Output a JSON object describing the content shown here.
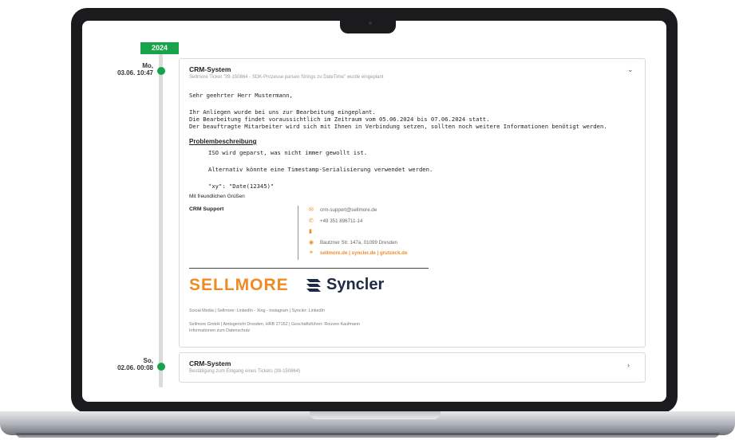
{
  "timeline": {
    "year": "2024",
    "entries": [
      {
        "day": "Mo,",
        "datetime": "03.06. 10:47",
        "title": "CRM-System",
        "subtitle": "Sellmore Ticket \"39-150864 - SDK-Prozesse parsen Strings zu DateTime\" wurde eingeplant",
        "greeting": "Sehr geehrter Herr Mustermann,",
        "body_lines": [
          "Ihr Anliegen wurde bei uns zur Bearbeitung eingeplant.",
          "Die Bearbeitung findet voraussichtlich im Zeitraum vom 05.06.2024 bis 07.06.2024 statt.",
          "Der beauftragte Mitarbeiter wird sich mit Ihnen in Verbindung setzen, sollten noch weitere Informationen benötigt werden."
        ],
        "problem_heading": "Problembeschreibung",
        "problem_lines": [
          "ISO wird geparst, was nicht immer gewollt ist.",
          "Alternativ könnte eine Timestamp-Serialisierung verwendet werden.",
          "\"xy\": \"Date(12345)\""
        ],
        "closing": "Mit freundlichen Grüßen",
        "signature_name": "CRM Support",
        "contact": {
          "email": "crm-support@sellmore.de",
          "phone": "+49 351 896711-14",
          "address": "Bautzner Str. 147a, 01099 Dresden",
          "links": "sellmore.de | syncler.de | grutzeck.de"
        },
        "logos": {
          "sellmore": "SELLMORE",
          "syncler": "Syncler"
        },
        "social": "Social Media | Sellmore: LinkedIn - Xing - Instagram | Syncler: LinkedIn",
        "legal_1": "Sellmore GmbH | Amtsgericht Dresden, HRB 27152 | Geschäftsführer: Rouven Kaufmann",
        "legal_2": "Informationen zum Datenschutz",
        "expanded_icon": "chevron-down-icon"
      },
      {
        "day": "So,",
        "datetime": "02.06. 00:08",
        "title": "CRM-System",
        "subtitle": "Bestätigung zum Eingang eines Tickets (39-150864)",
        "collapsed_icon": "chevron-right-icon"
      }
    ]
  },
  "colors": {
    "accent_green": "#16a34a",
    "sellmore_orange": "#f08a24",
    "syncler_navy": "#1f2a44"
  }
}
